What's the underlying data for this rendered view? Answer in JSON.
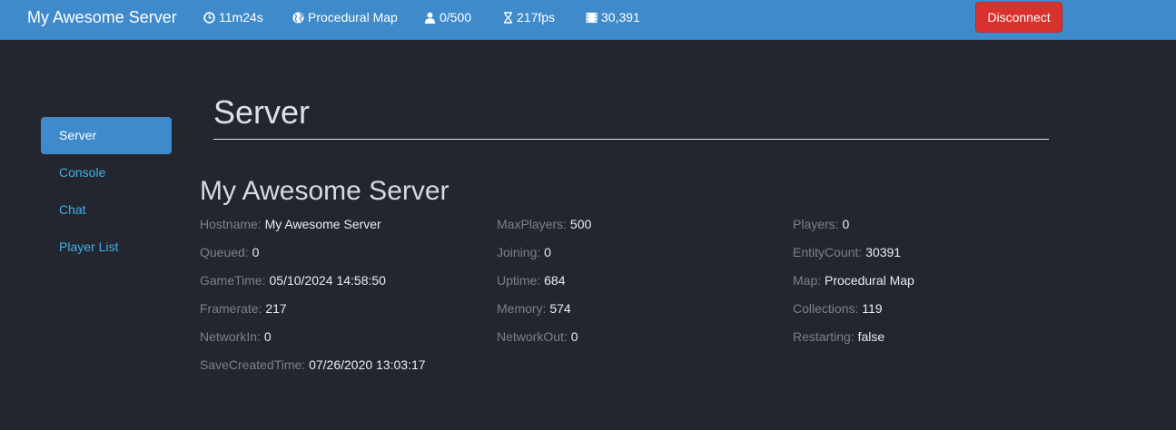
{
  "navbar": {
    "brand": "My Awesome Server",
    "stats": [
      {
        "icon": "clock-icon",
        "text": "11m24s"
      },
      {
        "icon": "globe-icon",
        "text": "Procedural Map"
      },
      {
        "icon": "user-icon",
        "text": "0/500"
      },
      {
        "icon": "hourglass-icon",
        "text": "217fps"
      },
      {
        "icon": "film-icon",
        "text": "30,391"
      }
    ],
    "disconnect_label": "Disconnect"
  },
  "sidebar": {
    "items": [
      {
        "label": "Server",
        "active": true
      },
      {
        "label": "Console",
        "active": false
      },
      {
        "label": "Chat",
        "active": false
      },
      {
        "label": "Player List",
        "active": false
      }
    ]
  },
  "main": {
    "title": "Server",
    "server_name": "My Awesome Server",
    "columns": [
      [
        {
          "key": "Hostname:",
          "value": "My Awesome Server"
        },
        {
          "key": "Queued:",
          "value": "0"
        },
        {
          "key": "GameTime:",
          "value": "05/10/2024 14:58:50"
        },
        {
          "key": "Framerate:",
          "value": "217"
        },
        {
          "key": "NetworkIn:",
          "value": "0"
        },
        {
          "key": "SaveCreatedTime:",
          "value": "07/26/2020 13:03:17"
        }
      ],
      [
        {
          "key": "MaxPlayers:",
          "value": "500"
        },
        {
          "key": "Joining:",
          "value": "0"
        },
        {
          "key": "Uptime:",
          "value": "684"
        },
        {
          "key": "Memory:",
          "value": "574"
        },
        {
          "key": "NetworkOut:",
          "value": "0"
        }
      ],
      [
        {
          "key": "Players:",
          "value": "0"
        },
        {
          "key": "EntityCount:",
          "value": "30391"
        },
        {
          "key": "Map:",
          "value": "Procedural Map"
        },
        {
          "key": "Collections:",
          "value": "119"
        },
        {
          "key": "Restarting:",
          "value": "false"
        }
      ]
    ]
  },
  "colors": {
    "navbar": "#3f8acb",
    "background": "#24262f",
    "danger": "#d9312d",
    "link": "#3eb0e8"
  }
}
